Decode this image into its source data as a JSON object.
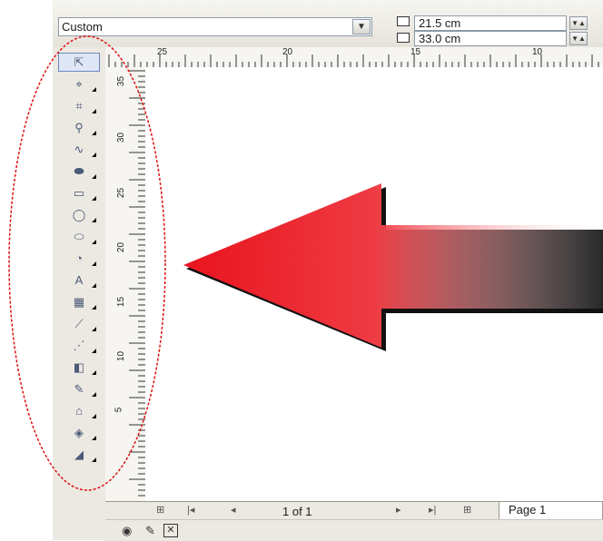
{
  "property_bar": {
    "page_preset": "Custom",
    "page_width": "21.5 cm",
    "page_height": "33.0 cm"
  },
  "toolbox": {
    "tools": [
      {
        "name": "pick-tool",
        "icon": "pointer-icon",
        "glyph": "⇱",
        "selected": true
      },
      {
        "name": "shape-tool",
        "icon": "shape-edit-icon",
        "glyph": "⌖"
      },
      {
        "name": "crop-tool",
        "icon": "crop-icon",
        "glyph": "⌗"
      },
      {
        "name": "zoom-tool",
        "icon": "magnifier-icon",
        "glyph": "⚲"
      },
      {
        "name": "freehand-tool",
        "icon": "freehand-icon",
        "glyph": "∿"
      },
      {
        "name": "smart-fill-tool",
        "icon": "smart-fill-icon",
        "glyph": "⬬"
      },
      {
        "name": "rectangle-tool",
        "icon": "rectangle-icon",
        "glyph": "▭"
      },
      {
        "name": "ellipse-tool",
        "icon": "ellipse-icon",
        "glyph": "◯"
      },
      {
        "name": "polygon-tool",
        "icon": "polygon-icon",
        "glyph": "⬭"
      },
      {
        "name": "basic-shapes-tool",
        "icon": "basic-shapes-icon",
        "glyph": "◔"
      },
      {
        "name": "text-tool",
        "icon": "text-icon",
        "glyph": "A"
      },
      {
        "name": "table-tool",
        "icon": "table-icon",
        "glyph": "▦"
      },
      {
        "name": "dimension-tool",
        "icon": "dimension-icon",
        "glyph": "⟋"
      },
      {
        "name": "connector-tool",
        "icon": "connector-icon",
        "glyph": "⋰"
      },
      {
        "name": "blend-tool",
        "icon": "blend-icon",
        "glyph": "◧"
      },
      {
        "name": "eyedropper-tool",
        "icon": "eyedropper-icon",
        "glyph": "✎"
      },
      {
        "name": "outline-tool",
        "icon": "outline-pen-icon",
        "glyph": "⌂"
      },
      {
        "name": "fill-tool",
        "icon": "fill-bucket-icon",
        "glyph": "◈"
      },
      {
        "name": "interactive-fill-tool",
        "icon": "interactive-fill-icon",
        "glyph": "◢"
      }
    ]
  },
  "rulers": {
    "units": "centimeters",
    "top_labels": [
      "25",
      "20",
      "15",
      "10"
    ],
    "left_labels": [
      "35",
      "30",
      "25",
      "20",
      "15",
      "10",
      "5"
    ]
  },
  "page_nav": {
    "page_count": "1 of 1",
    "page_tab": "Page 1"
  },
  "colors": {
    "arrow_red": "#e8141e",
    "ellipse_red": "#e01010",
    "selected_tool_border": "#6d87c2"
  }
}
